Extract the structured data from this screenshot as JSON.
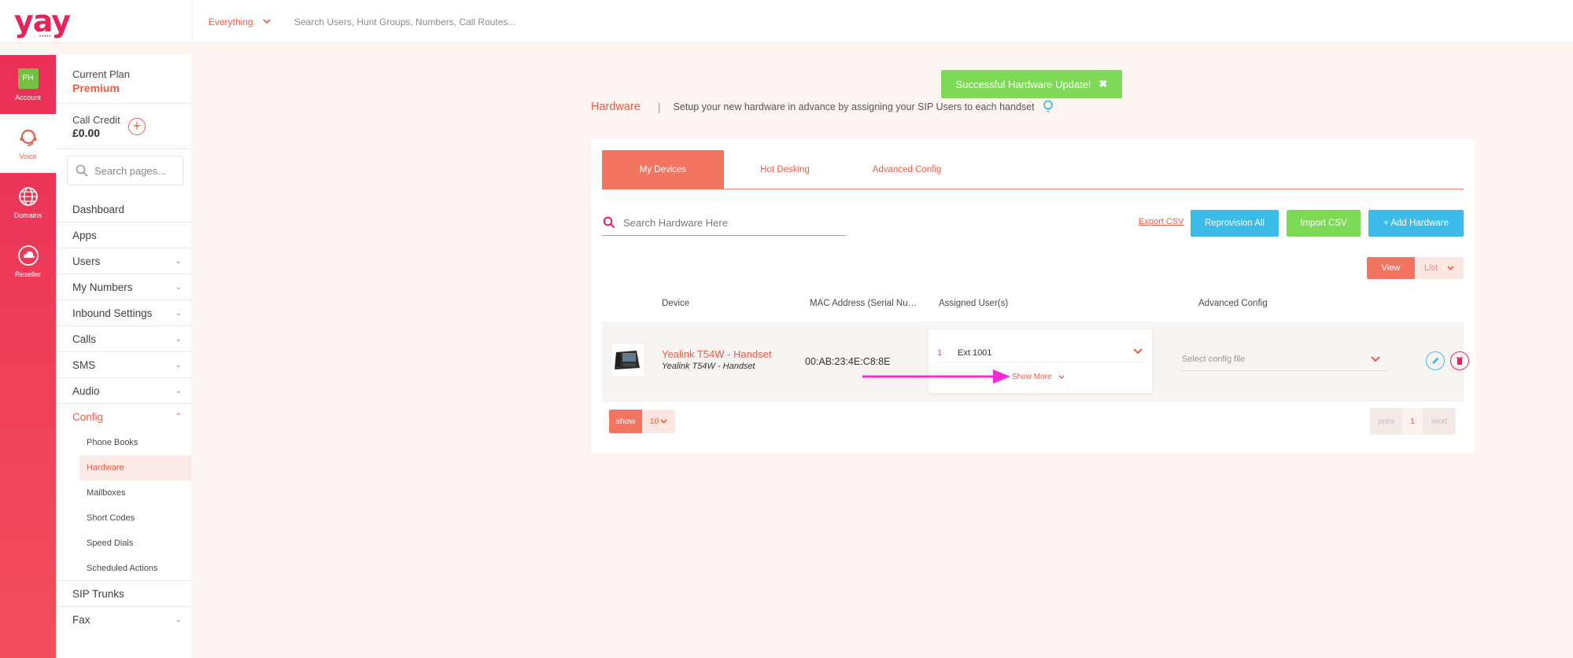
{
  "brand": {
    "logo": "yay",
    "logo_dots": "•••••",
    "accent": "#ef5a44",
    "rail_gradient": [
      "#ea2f57",
      "#f24f5b"
    ]
  },
  "topbar": {
    "filter_label": "Everything",
    "search_placeholder": "Search Users, Hunt Groups, Numbers, Call Routes..."
  },
  "rail": {
    "account": {
      "initials": "PH",
      "label": "Account"
    },
    "items": [
      {
        "label": "Voice",
        "icon": "headset-icon",
        "active": true
      },
      {
        "label": "Domains",
        "icon": "globe-icon",
        "active": false
      },
      {
        "label": "Reseller",
        "icon": "cloud-icon",
        "active": false
      }
    ]
  },
  "sidebar": {
    "plan_label": "Current Plan",
    "plan_value": "Premium",
    "credit_label": "Call Credit",
    "credit_value": "£0.00",
    "search_placeholder": "Search pages...",
    "items": [
      {
        "label": "Dashboard",
        "caret": ""
      },
      {
        "label": "Apps",
        "caret": ""
      },
      {
        "label": "Users",
        "caret": "⌄"
      },
      {
        "label": "My Numbers",
        "caret": "⌄"
      },
      {
        "label": "Inbound Settings",
        "caret": "⌄"
      },
      {
        "label": "Calls",
        "caret": "⌄"
      },
      {
        "label": "SMS",
        "caret": "⌄"
      },
      {
        "label": "Audio",
        "caret": "⌄"
      },
      {
        "label": "Config",
        "caret": "⌃"
      }
    ],
    "config_sub": [
      "Phone Books",
      "Hardware",
      "Mailboxes",
      "Short Codes",
      "Speed Dials",
      "Scheduled Actions"
    ],
    "items_after": [
      {
        "label": "SIP Trunks",
        "caret": ""
      },
      {
        "label": "Fax",
        "caret": "⌄"
      }
    ]
  },
  "toast": {
    "text": "Successful Hardware Update!",
    "close": "✖"
  },
  "page": {
    "title": "Hardware",
    "separator": "|",
    "description": "Setup your new hardware in advance by assigning your SIP Users to each handset"
  },
  "tabs": [
    "My Devices",
    "Hot Desking",
    "Advanced Config"
  ],
  "toolbar": {
    "search_placeholder": "Search Hardware Here",
    "export_label": "Export CSV",
    "reprovision_label": "Reprovision All",
    "import_label": "Import CSV",
    "add_label": "+ Add Hardware"
  },
  "view_toggle": {
    "view": "View",
    "list": "List"
  },
  "table": {
    "columns": [
      "Device",
      "MAC Address (Serial Nu…",
      "Assigned User(s)",
      "Advanced Config"
    ],
    "rows": [
      {
        "device_name": "Yealink T54W - Handset",
        "device_model": "Yealink T54W - Handset",
        "mac": "00:AB:23:4E:C8:8E",
        "user_index": "1",
        "user_ext": "Ext 1001",
        "show_more": "Show More",
        "config_placeholder": "Select config file"
      }
    ]
  },
  "pagination": {
    "show_label": "show",
    "show_count": "10",
    "prev": "prev",
    "current": "1",
    "next": "next"
  }
}
